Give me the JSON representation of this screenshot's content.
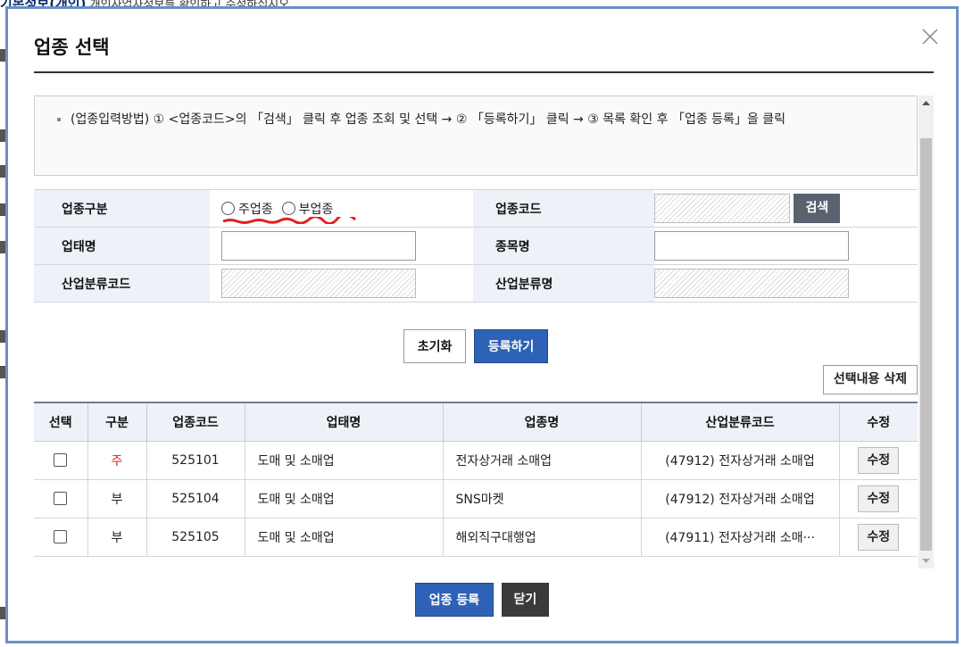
{
  "background": {
    "top_title": "기본정보(개인)",
    "top_text": "개인사업자정보를 확인하고 수정하십시오."
  },
  "modal": {
    "title": "업종 선택",
    "close_icon": "close-x-icon"
  },
  "guide": {
    "text": "(업종입력방법) ① <업종코드>의 「검색」 클릭 후 업종 조회 및 선택 → ② 「등록하기」 클릭 → ③ 목록 확인 후 「업종 등록」을 클릭"
  },
  "form": {
    "type_label": "업종구분",
    "radio_main": "주업종",
    "radio_sub": "부업종",
    "code_label": "업종코드",
    "search_button": "검색",
    "business_label": "업태명",
    "item_label": "종목명",
    "industry_code_label": "산업분류코드",
    "industry_name_label": "산업분류명"
  },
  "buttons": {
    "reset": "초기화",
    "register": "등록하기",
    "delete_selected": "선택내용 삭제",
    "submit": "업종 등록",
    "close": "닫기"
  },
  "table": {
    "headers": [
      "선택",
      "구분",
      "업종코드",
      "업태명",
      "업종명",
      "산업분류코드",
      "수정"
    ],
    "rows": [
      {
        "kind": "주",
        "code": "525101",
        "business": "도매 및 소매업",
        "item": "전자상거래 소매업",
        "industry": "(47912) 전자상거래 소매업",
        "edit": "수정"
      },
      {
        "kind": "부",
        "code": "525104",
        "business": "도매 및 소매업",
        "item": "SNS마켓",
        "industry": "(47912) 전자상거래 소매업",
        "edit": "수정"
      },
      {
        "kind": "부",
        "code": "525105",
        "business": "도매 및 소매업",
        "item": "해외직구대행업",
        "industry": "(47911) 전자상거래 소매···",
        "edit": "수정"
      }
    ]
  },
  "colors": {
    "modal_border": "#6a8fc4",
    "primary_blue": "#2e62b6",
    "main_kind_red": "#e02020"
  }
}
